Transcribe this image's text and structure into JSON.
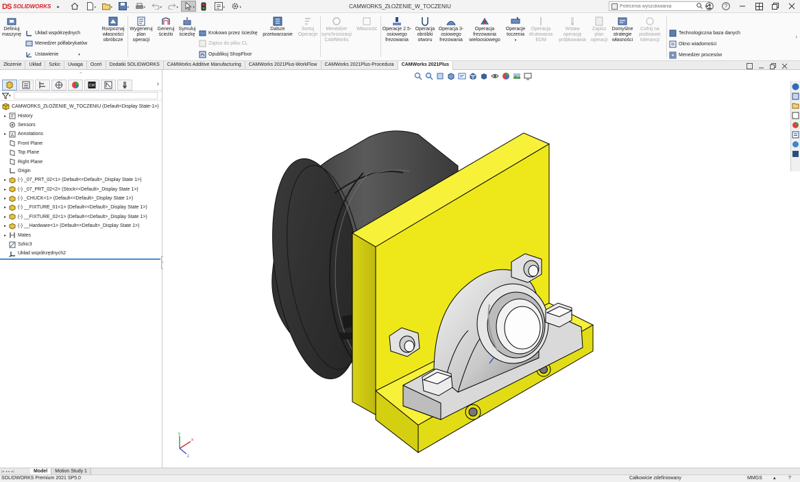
{
  "app": {
    "logo_mark": "DS",
    "logo_text": "SOLIDWORKS",
    "document_title": "CAMWORKS_ZŁOŻENIE_W_TOCZENIU"
  },
  "quick_access": {
    "icons": [
      "home-icon",
      "new-document-icon",
      "open-icon",
      "save-icon",
      "print-icon",
      "undo-icon",
      "redo-icon",
      "select-icon",
      "traffic-light-icon",
      "file-properties-icon",
      "options-icon"
    ]
  },
  "search": {
    "placeholder": "Polecenia wyszukiwania"
  },
  "ribbon": {
    "define_machine": "Definiuj maszynę",
    "coordinate_system": "Układ współrzędnych",
    "stock_manager": "Menedżer półfabrykatów",
    "setup": "Ustawienie",
    "recognize_features": "Rozpoznaj własności obróbcze",
    "generate_plan": "Wygeneruj plan operacji",
    "generate_toolpath": "Generuj ścieżki",
    "simulate_toolpath": "Symuluj ścieżkę",
    "step_through": "Krokowo przez ścieżkę",
    "save_cl": "Zapisz do pliku CL",
    "publish_shopfloor": "Opublikuj ShopFloor",
    "post_process": "Dalsze przetwarzanie",
    "sort_operations": "Sortuj Operacje",
    "sync_manager": "Menedżer synchronizacji CAMWorks",
    "property": "Własność",
    "ops_25axis": "Operacje 2.5-osiowego frezowania",
    "ops_hole": "Operacja obróbki otworu",
    "ops_3axis": "Operacja 3-osiowego frezowania",
    "ops_multiaxis": "Operacja frezowania wieloosiowego",
    "ops_turning": "Operacje toczenia",
    "wire_edm": "Operacja drutowania EDM",
    "insert_probing": "Wstaw operację próbkowania",
    "save_plan": "Zapisz plan operacji",
    "default_strategy": "Domyślne strategie własności",
    "tolerance_return": "Cofnij na podstawie tolerancji",
    "tech_db": "Technologiczna baza danych",
    "message_window": "Okno wiadomości",
    "process_manager": "Menedżer procesów"
  },
  "tabs": [
    "Złożenie",
    "Układ",
    "Szkic",
    "Uwaga",
    "Oceń",
    "Dodatki SOLIDWORKS",
    "CAMWorks Additive Manufacturing",
    "CAMWorks 2021Plus-WorkFlow",
    "CAMWorks 2021Plus-Procedura",
    "CAMWorks 2021Plus"
  ],
  "active_tab": "CAMWorks 2021Plus",
  "tree": {
    "root": "CAMWORKS_ZŁOŻENIE_W_TOCZENIU  (Default<Display State-1>)",
    "items": [
      {
        "label": "History",
        "icon": "history-icon",
        "expander": "▸"
      },
      {
        "label": "Sensors",
        "icon": "sensor-icon",
        "expander": ""
      },
      {
        "label": "Annotations",
        "icon": "annotations-icon",
        "expander": "▸"
      },
      {
        "label": "Front Plane",
        "icon": "plane-icon",
        "expander": ""
      },
      {
        "label": "Top Plane",
        "icon": "plane-icon",
        "expander": ""
      },
      {
        "label": "Right Plane",
        "icon": "plane-icon",
        "expander": ""
      },
      {
        "label": "Origin",
        "icon": "origin-icon",
        "expander": ""
      },
      {
        "label": "(-) _07_PRT_02<1> (Default<<Default>_Display State 1>)",
        "icon": "part-icon",
        "expander": "▸"
      },
      {
        "label": "(-) _07_PRT_02<2> (Stock<<Default>_Display State 1>)",
        "icon": "part-icon",
        "expander": "▸"
      },
      {
        "label": "(-) _CHUCK<1> (Default<<Default>_Display State 1>)",
        "icon": "part-icon",
        "expander": "▸"
      },
      {
        "label": "(-) __FIXTURE_01<1> (Default<<Default>_Display State 1>)",
        "icon": "part-icon",
        "expander": "▸"
      },
      {
        "label": "(-) __FIXTURE_02<1> (Default<<Default>_Display State 1>)",
        "icon": "part-icon",
        "expander": "▸"
      },
      {
        "label": "(-) __Hardware<1> (Default<<Default>_Display State 1>)",
        "icon": "part-icon",
        "expander": "▸"
      },
      {
        "label": "Mates",
        "icon": "mates-icon",
        "expander": "▸"
      },
      {
        "label": "Szkic3",
        "icon": "sketch-icon",
        "expander": ""
      },
      {
        "label": "Układ współrzędnych2",
        "icon": "coordinate-system-icon",
        "expander": ""
      }
    ]
  },
  "bottom_tabs": [
    "Model",
    "Motion Study 1"
  ],
  "status": {
    "version": "SOLIDWORKS Premium 2021 SP5.0",
    "definition": "Całkowicie zdefiniowany",
    "units": "MMGS"
  },
  "colors": {
    "fixture_yellow": "#f0ea1a",
    "chuck_gray": "#4a4a4a",
    "accent_blue": "#4a89d4",
    "logo_red": "#d71e28"
  }
}
